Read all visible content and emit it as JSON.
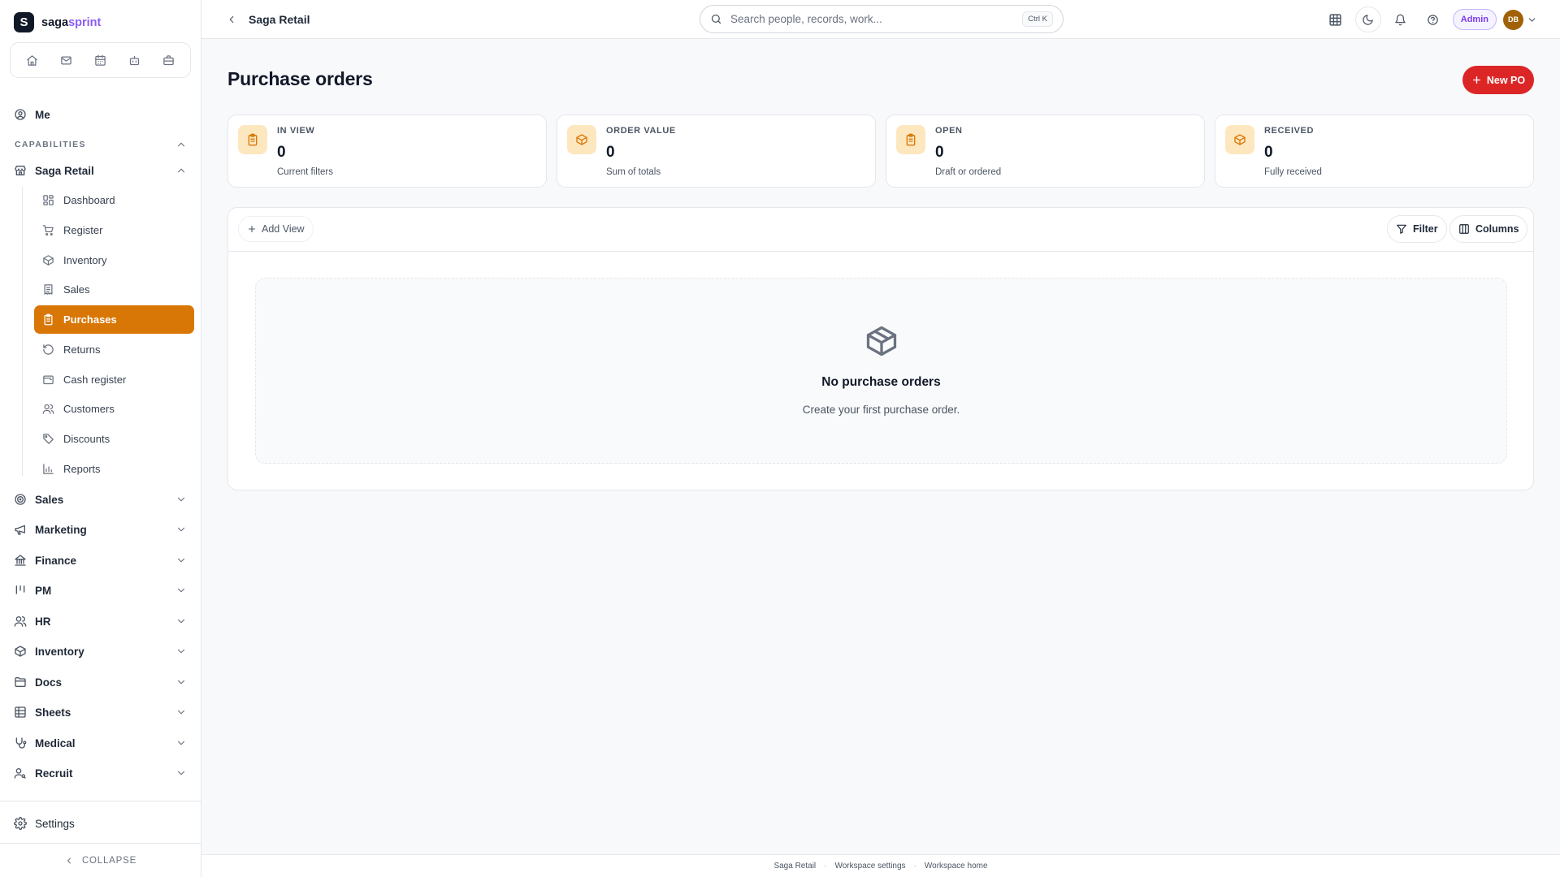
{
  "brand": {
    "name_prefix": "saga",
    "name_suffix": "sprint",
    "logo_letter": "S"
  },
  "quickbar": [
    {
      "icon": "home-icon"
    },
    {
      "icon": "mail-icon"
    },
    {
      "icon": "calendar-icon"
    },
    {
      "icon": "bot-icon"
    },
    {
      "icon": "briefcase-icon"
    }
  ],
  "sidebar": {
    "me_label": "Me",
    "capabilities_label": "CAPABILITIES",
    "workspace": {
      "label": "Saga Retail",
      "expanded": true
    },
    "sub_items": [
      {
        "label": "Dashboard",
        "icon": "layout-grid-icon",
        "active": false
      },
      {
        "label": "Register",
        "icon": "cart-icon",
        "active": false
      },
      {
        "label": "Inventory",
        "icon": "box-icon",
        "active": false
      },
      {
        "label": "Sales",
        "icon": "receipt-icon",
        "active": false
      },
      {
        "label": "Purchases",
        "icon": "clipboard-icon",
        "active": true
      },
      {
        "label": "Returns",
        "icon": "rotate-icon",
        "active": false
      },
      {
        "label": "Cash register",
        "icon": "wallet-icon",
        "active": false
      },
      {
        "label": "Customers",
        "icon": "users-icon",
        "active": false
      },
      {
        "label": "Discounts",
        "icon": "tag-icon",
        "active": false
      },
      {
        "label": "Reports",
        "icon": "bar-chart-icon",
        "active": false
      }
    ],
    "groups": [
      {
        "label": "Sales",
        "icon": "target-icon"
      },
      {
        "label": "Marketing",
        "icon": "megaphone-icon"
      },
      {
        "label": "Finance",
        "icon": "bank-icon"
      },
      {
        "label": "PM",
        "icon": "kanban-icon"
      },
      {
        "label": "HR",
        "icon": "users-icon"
      },
      {
        "label": "Inventory",
        "icon": "box-icon"
      },
      {
        "label": "Docs",
        "icon": "folder-icon"
      },
      {
        "label": "Sheets",
        "icon": "table-icon"
      },
      {
        "label": "Medical",
        "icon": "stethoscope-icon"
      },
      {
        "label": "Recruit",
        "icon": "user-search-icon"
      }
    ],
    "settings_label": "Settings",
    "collapse_label": "COLLAPSE"
  },
  "topbar": {
    "breadcrumb": "Saga Retail",
    "search_placeholder": "Search people, records, work...",
    "search_shortcut": "Ctrl K",
    "role_badge": "Admin",
    "avatar_initials": "DB"
  },
  "page": {
    "title": "Purchase orders",
    "new_button": "New PO"
  },
  "stats": [
    {
      "label": "IN VIEW",
      "value": "0",
      "sub": "Current filters",
      "icon": "clipboard-icon"
    },
    {
      "label": "ORDER VALUE",
      "value": "0",
      "sub": "Sum of totals",
      "icon": "box-icon"
    },
    {
      "label": "OPEN",
      "value": "0",
      "sub": "Draft or ordered",
      "icon": "clipboard-icon"
    },
    {
      "label": "RECEIVED",
      "value": "0",
      "sub": "Fully received",
      "icon": "box-icon"
    }
  ],
  "table": {
    "add_view_label": "Add View",
    "filter_label": "Filter",
    "columns_label": "Columns",
    "empty_title": "No purchase orders",
    "empty_subtitle": "Create your first purchase order."
  },
  "footer": {
    "links": [
      "Saga Retail",
      "Workspace settings",
      "Workspace home"
    ],
    "separator": "·"
  },
  "colors": {
    "active_nav": "#d97706",
    "primary_button": "#dc2626",
    "stat_icon_bg": "#fde7bf",
    "admin_badge": "#7c3aed"
  }
}
